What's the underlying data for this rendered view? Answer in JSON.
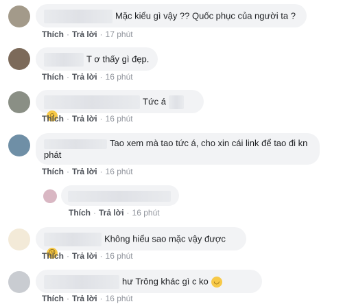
{
  "action_labels": {
    "like": "Thích",
    "reply": "Trả lời"
  },
  "comments": [
    {
      "text": "Mặc kiểu   gì vậy ?? Quốc phục của người ta ?",
      "time": "17 phút"
    },
    {
      "text": "T ơ thấy gì đẹp.",
      "time": "16 phút"
    },
    {
      "text": "Tức á",
      "time": "16 phút",
      "emoji": "smile-emoji"
    },
    {
      "text": "Tao xem mà tao tức á, cho xin cái link để tao đi kn phát",
      "time": "16 phút"
    },
    {
      "text": "",
      "time": "16 phút"
    },
    {
      "text": "Không hiểu sao mặc vậy được",
      "time": "16 phút",
      "emoji": "confused-emoji"
    },
    {
      "text_suffix": "hư",
      "text": "Trông khác   gì c ko",
      "time": "16 phút",
      "emoji": "upside-down-emoji"
    }
  ],
  "reply_time": "16 phút"
}
